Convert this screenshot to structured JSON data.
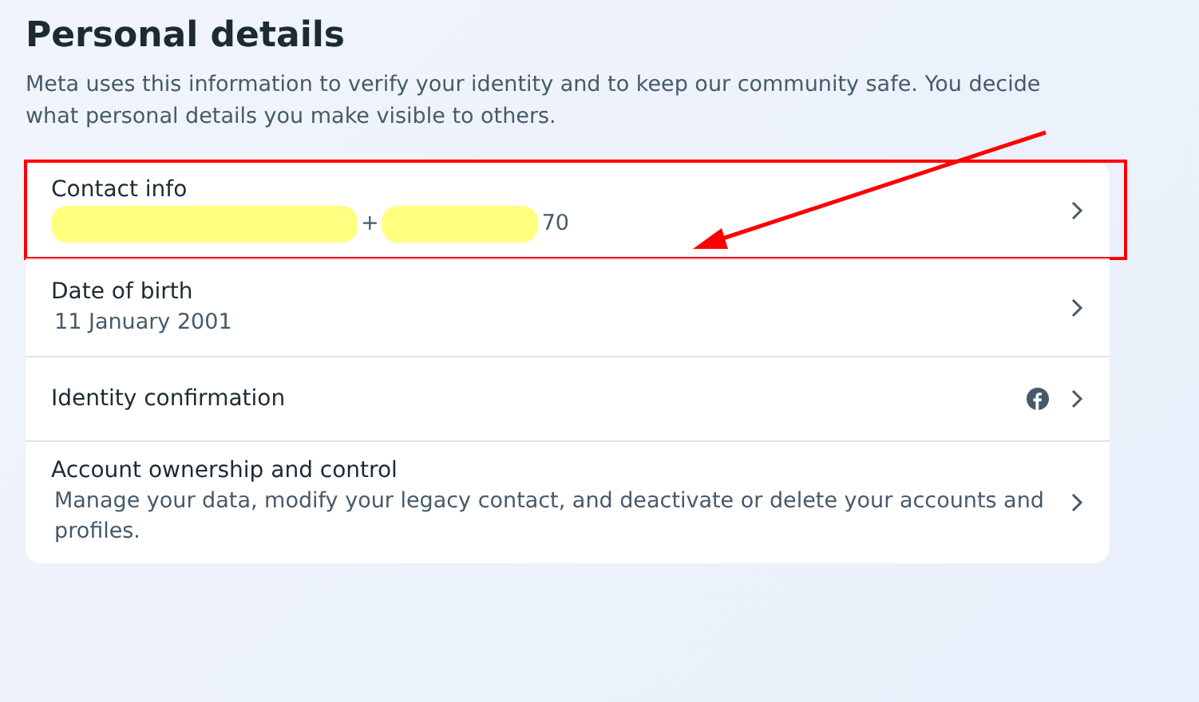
{
  "title": "Personal details",
  "description": "Meta uses this information to verify your identity and to keep our community safe. You decide what personal details you make visible to others.",
  "rows": [
    {
      "label": "Contact info",
      "value_parts": [
        {
          "kind": "redacted"
        },
        {
          "kind": "text",
          "text": "+"
        },
        {
          "kind": "redacted"
        },
        {
          "kind": "text",
          "text": "70"
        }
      ],
      "highlighted": true
    },
    {
      "label": "Date of birth",
      "value_parts": [
        {
          "kind": "text",
          "text": "11 January 2001"
        }
      ],
      "highlighted": false
    },
    {
      "label": "Identity confirmation",
      "kind": "linked",
      "highlighted": false
    },
    {
      "label": "Account ownership and control",
      "value_parts": [
        {
          "kind": "text",
          "text": "Manage your data, modify your legacy contact, and deactivate or delete your accounts and profiles."
        }
      ],
      "highlighted": false
    }
  ],
  "annotation": {
    "kind": "arrow"
  }
}
